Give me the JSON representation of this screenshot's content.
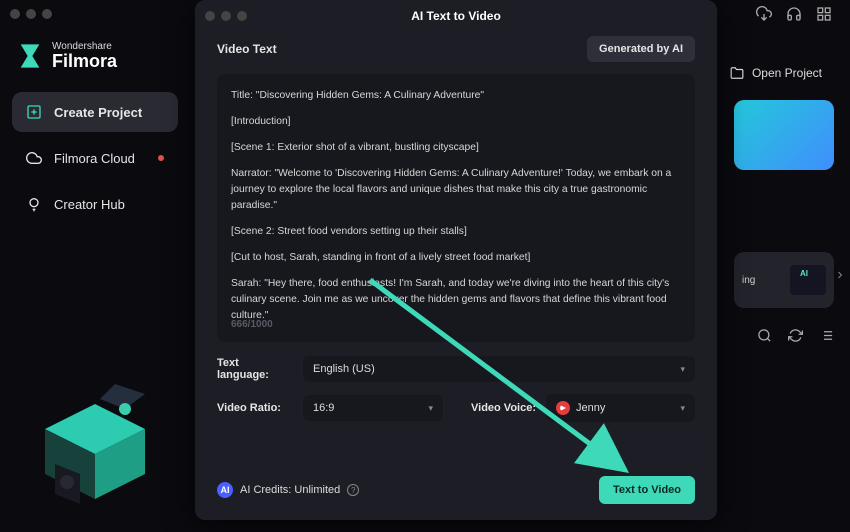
{
  "brand": {
    "sub": "Wondershare",
    "name": "Filmora"
  },
  "sidebar": {
    "items": [
      {
        "label": "Create Project",
        "active": true
      },
      {
        "label": "Filmora Cloud",
        "dot": true
      },
      {
        "label": "Creator Hub"
      }
    ]
  },
  "topbar": {
    "open_project": "Open Project"
  },
  "ai_card": {
    "label": "ing"
  },
  "modal": {
    "title": "AI Text to Video",
    "section_title": "Video Text",
    "generate_label": "Generated by AI",
    "script": {
      "title": "Title: \"Discovering Hidden Gems: A Culinary Adventure\"",
      "intro": "[Introduction]",
      "scene1": "[Scene 1: Exterior shot of a vibrant, bustling cityscape]",
      "narrator": "Narrator: \"Welcome to 'Discovering Hidden Gems: A Culinary Adventure!' Today, we embark on a journey to explore the local flavors and unique dishes that make this city a true gastronomic paradise.\"",
      "scene2": "[Scene 2: Street food vendors setting up their stalls]",
      "cut": "[Cut to host, Sarah, standing in front of a lively street food market]",
      "sarah": "Sarah: \"Hey there, food enthusiasts! I'm Sarah, and today we're diving into the heart of this city's culinary scene. Join me as we uncover the hidden gems and flavors that define this vibrant food culture.\""
    },
    "counter": "666/1000",
    "fields": {
      "language_label": "Text language:",
      "language_value": "English (US)",
      "ratio_label": "Video Ratio:",
      "ratio_value": "16:9",
      "voice_label": "Video Voice:",
      "voice_value": "Jenny"
    },
    "credits_label": "AI Credits: Unlimited",
    "cta_label": "Text to Video"
  }
}
